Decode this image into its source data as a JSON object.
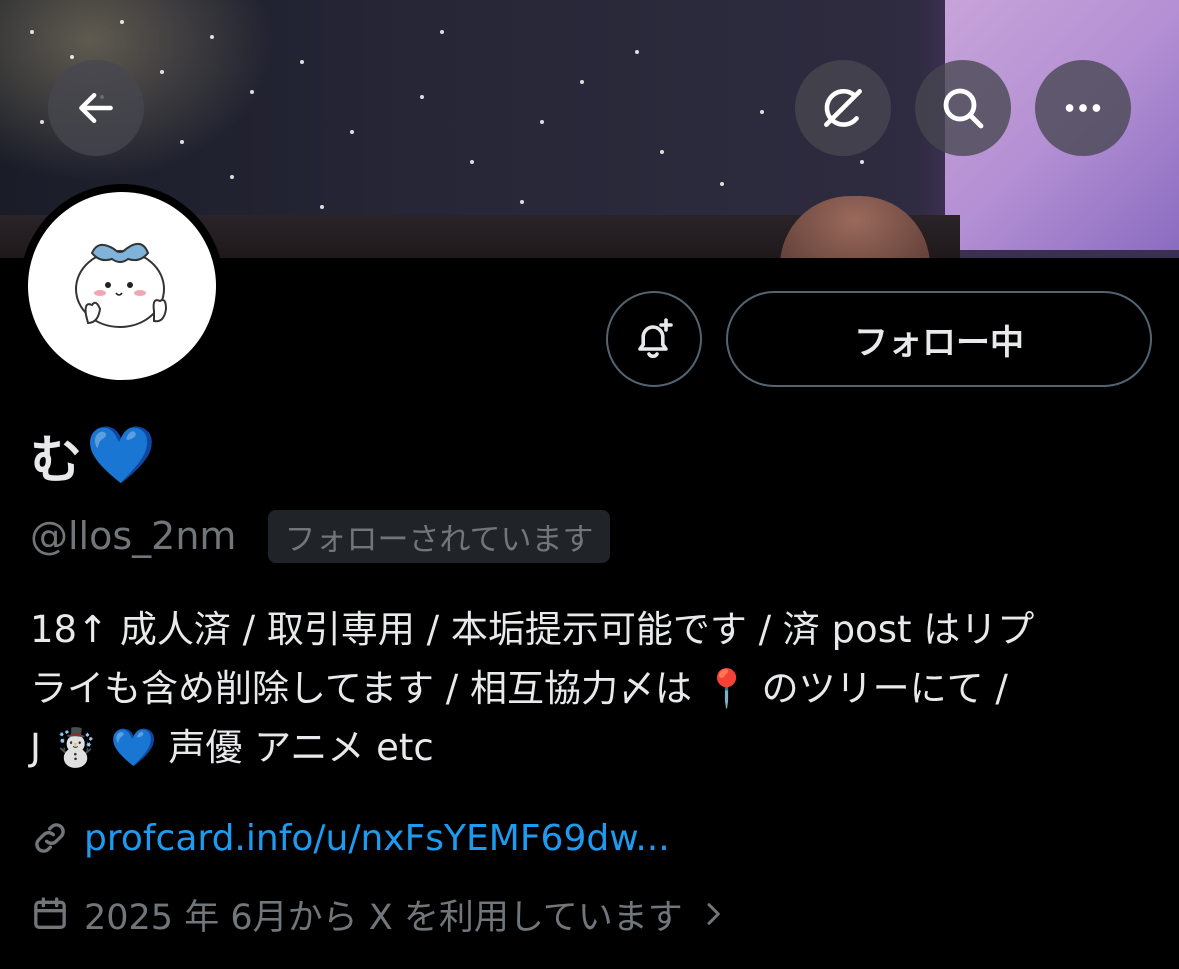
{
  "header": {
    "back_icon": "arrow-left-icon",
    "grok_icon": "grok-icon",
    "search_icon": "search-icon",
    "more_icon": "more-horizontal-icon"
  },
  "profile": {
    "avatar_icon": "avatar-character-icon",
    "notify_icon": "bell-plus-icon",
    "follow_button_label": "フォロー中",
    "name": "む",
    "name_emoji": "💙",
    "handle": "@llos_2nm",
    "follows_you_label": "フォローされています",
    "bio_line1": "18↑ 成人済 / 取引専用 / 本垢提示可能です / 済 post はリプ",
    "bio_line2": "ライも含め削除してます / 相互協力〆は 📍 のツリーにて /",
    "bio_line3": "J ☃️ 💙 声優 アニメ etc",
    "link_icon": "link-icon",
    "link_text": "profcard.info/u/nxFsYEMF69dw...",
    "calendar_icon": "calendar-icon",
    "joined_text": "2025 年 6月から X を利用しています",
    "chevron_icon": "chevron-right-icon"
  },
  "colors": {
    "background": "#000000",
    "text": "#e7e9ea",
    "muted": "#71767b",
    "link": "#1d9bf0",
    "border": "#536471"
  }
}
